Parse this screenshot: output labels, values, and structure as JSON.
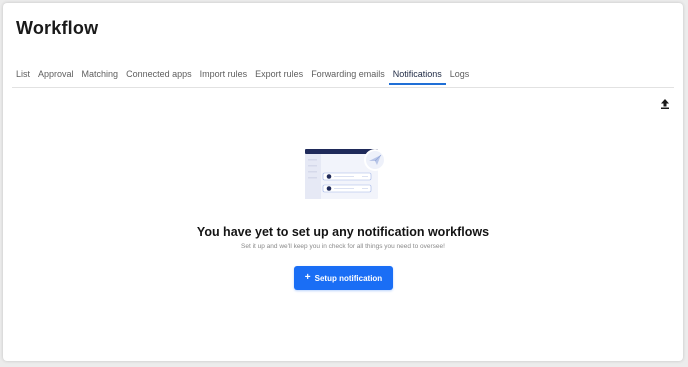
{
  "page": {
    "title": "Workflow"
  },
  "tabs": [
    {
      "label": "List",
      "active": false
    },
    {
      "label": "Approval",
      "active": false
    },
    {
      "label": "Matching",
      "active": false
    },
    {
      "label": "Connected apps",
      "active": false
    },
    {
      "label": "Import rules",
      "active": false
    },
    {
      "label": "Export rules",
      "active": false
    },
    {
      "label": "Forwarding emails",
      "active": false
    },
    {
      "label": "Notifications",
      "active": true
    },
    {
      "label": "Logs",
      "active": false
    }
  ],
  "toolbar": {
    "upload_icon": "upload-icon"
  },
  "empty_state": {
    "illustration_icon": "notification-workflow-illustration",
    "title": "You have yet to set up any notification workflows",
    "subtitle": "Set it up and we'll keep you in check for all things you need to oversee!",
    "button_label": "Setup notification",
    "button_icon": "plus-icon"
  },
  "colors": {
    "accent": "#1a6ef5",
    "active_tab_underline": "#1f6fd6",
    "illustration_header": "#1f2a5a"
  }
}
